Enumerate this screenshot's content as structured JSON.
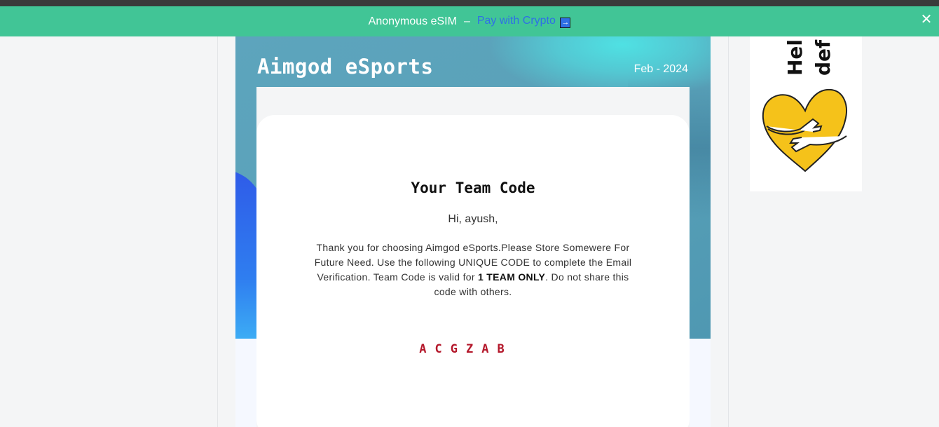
{
  "banner": {
    "text": "Anonymous eSIM",
    "separator": "–",
    "link_text": "Pay with Crypto",
    "arrow": "→",
    "close": "✕"
  },
  "email": {
    "brand": "Aimgod eSports",
    "date": "Feb - 2024",
    "title": "Your Team Code",
    "greeting": "Hi, ayush,",
    "message_part1": "Thank you for choosing Aimgod eSports.Please Store Somewere For Future Need. Use the following UNIQUE CODE to complete the Email Verification. Team Code is valid for ",
    "message_bold": "1 TEAM ONLY",
    "message_part2": ". Do not share this code with others.",
    "code": "ACGZAB"
  },
  "ad": {
    "line1": "Hel",
    "line2": "def"
  },
  "colors": {
    "banner_bg": "#41c596",
    "link": "#2f6fe6",
    "hero": "#5aa2b9",
    "code": "#b4182b"
  }
}
